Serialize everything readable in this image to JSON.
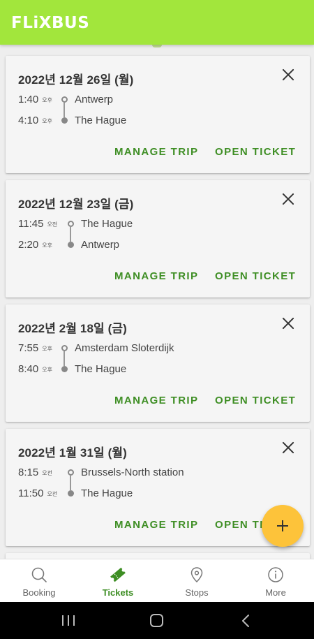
{
  "header": {
    "logo_text": "FLiXBUS",
    "brand_color": "#a2e63c"
  },
  "trips": [
    {
      "date": "2022년 12월 26일 (월)",
      "departure": {
        "time": "1:40",
        "period": "오후",
        "stop": "Antwerp"
      },
      "arrival": {
        "time": "4:10",
        "period": "오후",
        "stop": "The Hague"
      },
      "manage_label": "MANAGE TRIP",
      "open_label": "OPEN TICKET"
    },
    {
      "date": "2022년 12월 23일 (금)",
      "departure": {
        "time": "11:45",
        "period": "오전",
        "stop": "The Hague"
      },
      "arrival": {
        "time": "2:20",
        "period": "오후",
        "stop": "Antwerp"
      },
      "manage_label": "MANAGE TRIP",
      "open_label": "OPEN TICKET"
    },
    {
      "date": "2022년 2월 18일 (금)",
      "departure": {
        "time": "7:55",
        "period": "오후",
        "stop": "Amsterdam Sloterdijk"
      },
      "arrival": {
        "time": "8:40",
        "period": "오후",
        "stop": "The Hague"
      },
      "manage_label": "MANAGE TRIP",
      "open_label": "OPEN TICKET"
    },
    {
      "date": "2022년 1월 31일 (월)",
      "departure": {
        "time": "8:15",
        "period": "오전",
        "stop": "Brussels-North station"
      },
      "arrival": {
        "time": "11:50",
        "period": "오전",
        "stop": "The Hague"
      },
      "manage_label": "MANAGE TRIP",
      "open_label": "OPEN TI"
    }
  ],
  "fab": {
    "icon": "plus-icon",
    "color": "#fdc33a"
  },
  "bottom_nav": [
    {
      "label": "Booking",
      "icon": "search-icon",
      "active": false
    },
    {
      "label": "Tickets",
      "icon": "ticket-icon",
      "active": true
    },
    {
      "label": "Stops",
      "icon": "location-pin-icon",
      "active": false
    },
    {
      "label": "More",
      "icon": "info-icon",
      "active": false
    }
  ],
  "system_nav": {
    "buttons": [
      "recent-apps-icon",
      "home-icon",
      "back-icon"
    ]
  },
  "colors": {
    "accent_green": "#3e8e24",
    "card_bg": "#f5f5f5",
    "text_dark": "#333333"
  }
}
